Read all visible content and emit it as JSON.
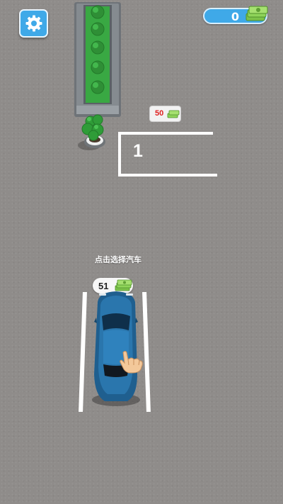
{
  "hud": {
    "settings_icon": "gear-icon",
    "money": "0",
    "money_icon": "cash-stack-icon"
  },
  "slot": {
    "price": "50",
    "price_icon": "cash-stack-icon",
    "number": "1"
  },
  "car_select": {
    "hint": "点击选择汽车",
    "price": "51",
    "price_icon": "cash-stack-icon",
    "tap_icon": "pointing-hand-icon"
  },
  "colors": {
    "ui_blue": "#3fa9e8",
    "car_blue": "#1f5f8f",
    "ground": "#8f8c8a",
    "hedge_green": "#2fa33a",
    "price_red": "#e02020"
  }
}
